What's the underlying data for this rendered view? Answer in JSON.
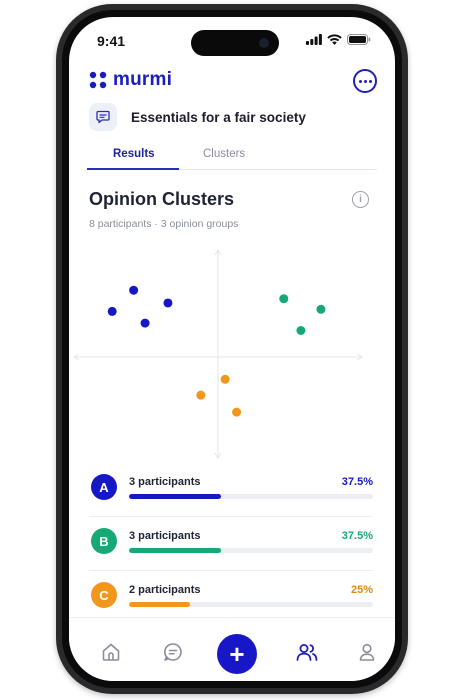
{
  "status_bar": {
    "time": "9:41"
  },
  "app": {
    "name": "murmi",
    "brand_color": "#1a1fb8"
  },
  "conversation": {
    "title": "Essentials for a fair society"
  },
  "tabs": [
    {
      "label": "Results",
      "active": true
    },
    {
      "label": "Clusters",
      "active": false
    }
  ],
  "section": {
    "title": "Opinion Clusters",
    "subtitle": "8 participants · 3 opinion groups",
    "info_glyph": "i"
  },
  "chart_data": {
    "type": "scatter",
    "xlim": [
      -1,
      1
    ],
    "ylim": [
      -1,
      1
    ],
    "series": [
      {
        "group": "A",
        "color": "#1518c4",
        "points": [
          [
            -0.59,
            0.63
          ],
          [
            -0.74,
            0.43
          ],
          [
            -0.35,
            0.51
          ],
          [
            -0.51,
            0.32
          ]
        ]
      },
      {
        "group": "B",
        "color": "#16a875",
        "points": [
          [
            0.46,
            0.55
          ],
          [
            0.72,
            0.45
          ],
          [
            0.58,
            0.25
          ]
        ]
      },
      {
        "group": "C",
        "color": "#f0971c",
        "points": [
          [
            0.05,
            -0.21
          ],
          [
            -0.12,
            -0.36
          ],
          [
            0.13,
            -0.52
          ]
        ]
      }
    ]
  },
  "groups": [
    {
      "letter": "A",
      "count_label": "3 participants",
      "percent_label": "37.5%",
      "fraction": 0.375,
      "color": "#1518c4"
    },
    {
      "letter": "B",
      "count_label": "3 participants",
      "percent_label": "37.5%",
      "fraction": 0.375,
      "color": "#16a875"
    },
    {
      "letter": "C",
      "count_label": "2 participants",
      "percent_label": "25%",
      "fraction": 0.25,
      "color": "#f0971c"
    }
  ],
  "nav": {
    "items": [
      "home-icon",
      "chat-icon",
      "add-icon",
      "people-icon",
      "profile-icon"
    ],
    "active": "people-icon",
    "fab_glyph": "+",
    "active_color": "#1f23b0",
    "inactive_color": "#8a8d9c"
  }
}
